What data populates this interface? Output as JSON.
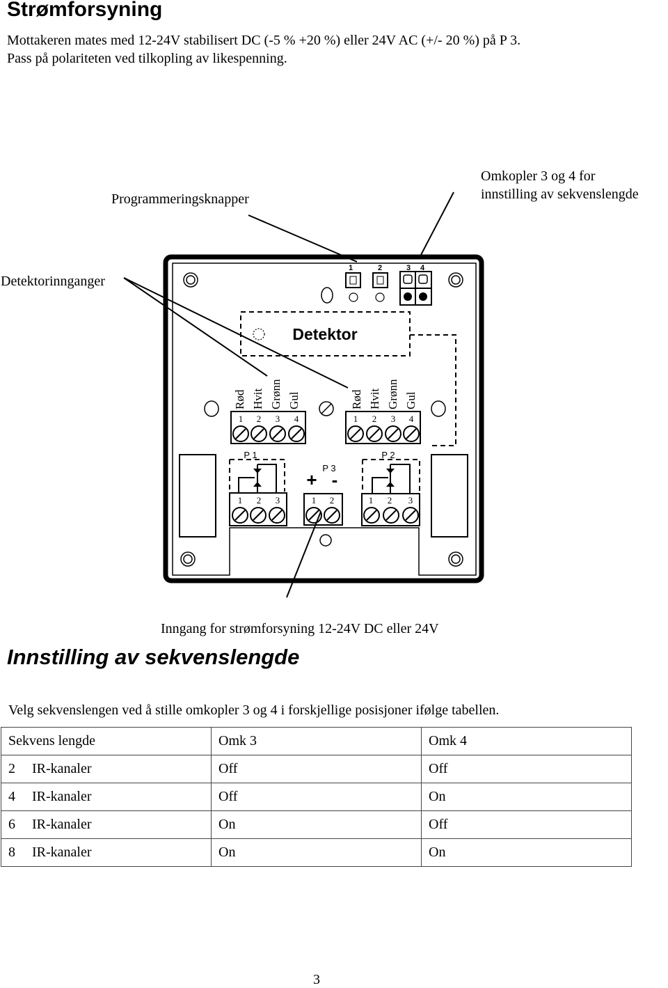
{
  "section1": {
    "title": "Strømforsyning",
    "paragraph_lines": [
      "Mottakeren mates med 12-24V stabilisert DC (-5 % +20 %) eller 24V AC (+/- 20 %) på P 3.",
      "Pass på polariteten ved tilkopling av likespenning."
    ]
  },
  "diagram": {
    "callouts": {
      "programming_buttons": "Programmeringsknapper",
      "switch_label_lines": [
        "Omkopler 3 og 4 for",
        "innstilling av sekvenslengde"
      ],
      "detector_inputs": "Detektorinnganger",
      "power_input": "Inngang for strømforsyning 12-24V DC eller 24V"
    },
    "button_numbers": [
      "1",
      "2"
    ],
    "switch_numbers": [
      "3",
      "4"
    ],
    "detector_label": "Detektor",
    "wire_colors": [
      "Rød",
      "Hvit",
      "Grønn",
      "Gul"
    ],
    "terminal_numbers_4": [
      "1",
      "2",
      "3",
      "4"
    ],
    "terminal_numbers_3": [
      "1",
      "2",
      "3"
    ],
    "terminal_numbers_2": [
      "1",
      "2"
    ],
    "connectors": {
      "p1": "P 1",
      "p2": "P 2",
      "p3": "P 3",
      "plus": "+",
      "minus": "-"
    }
  },
  "section2": {
    "title": "Innstilling av sekvenslengde",
    "intro": "Velg sekvenslengen ved å stille omkopler 3 og 4 i forskjellige posisjoner ifølge tabellen.",
    "table": {
      "headers": [
        "Sekvens lengde",
        "Omk 3",
        "Omk 4"
      ],
      "rows": [
        {
          "count": "2",
          "label": "IR-kanaler",
          "omk3": "Off",
          "omk4": "Off"
        },
        {
          "count": "4",
          "label": "IR-kanaler",
          "omk3": "Off",
          "omk4": "On"
        },
        {
          "count": "6",
          "label": "IR-kanaler",
          "omk3": "On",
          "omk4": "Off"
        },
        {
          "count": "8",
          "label": "IR-kanaler",
          "omk3": "On",
          "omk4": "On"
        }
      ]
    }
  },
  "page_number": "3"
}
